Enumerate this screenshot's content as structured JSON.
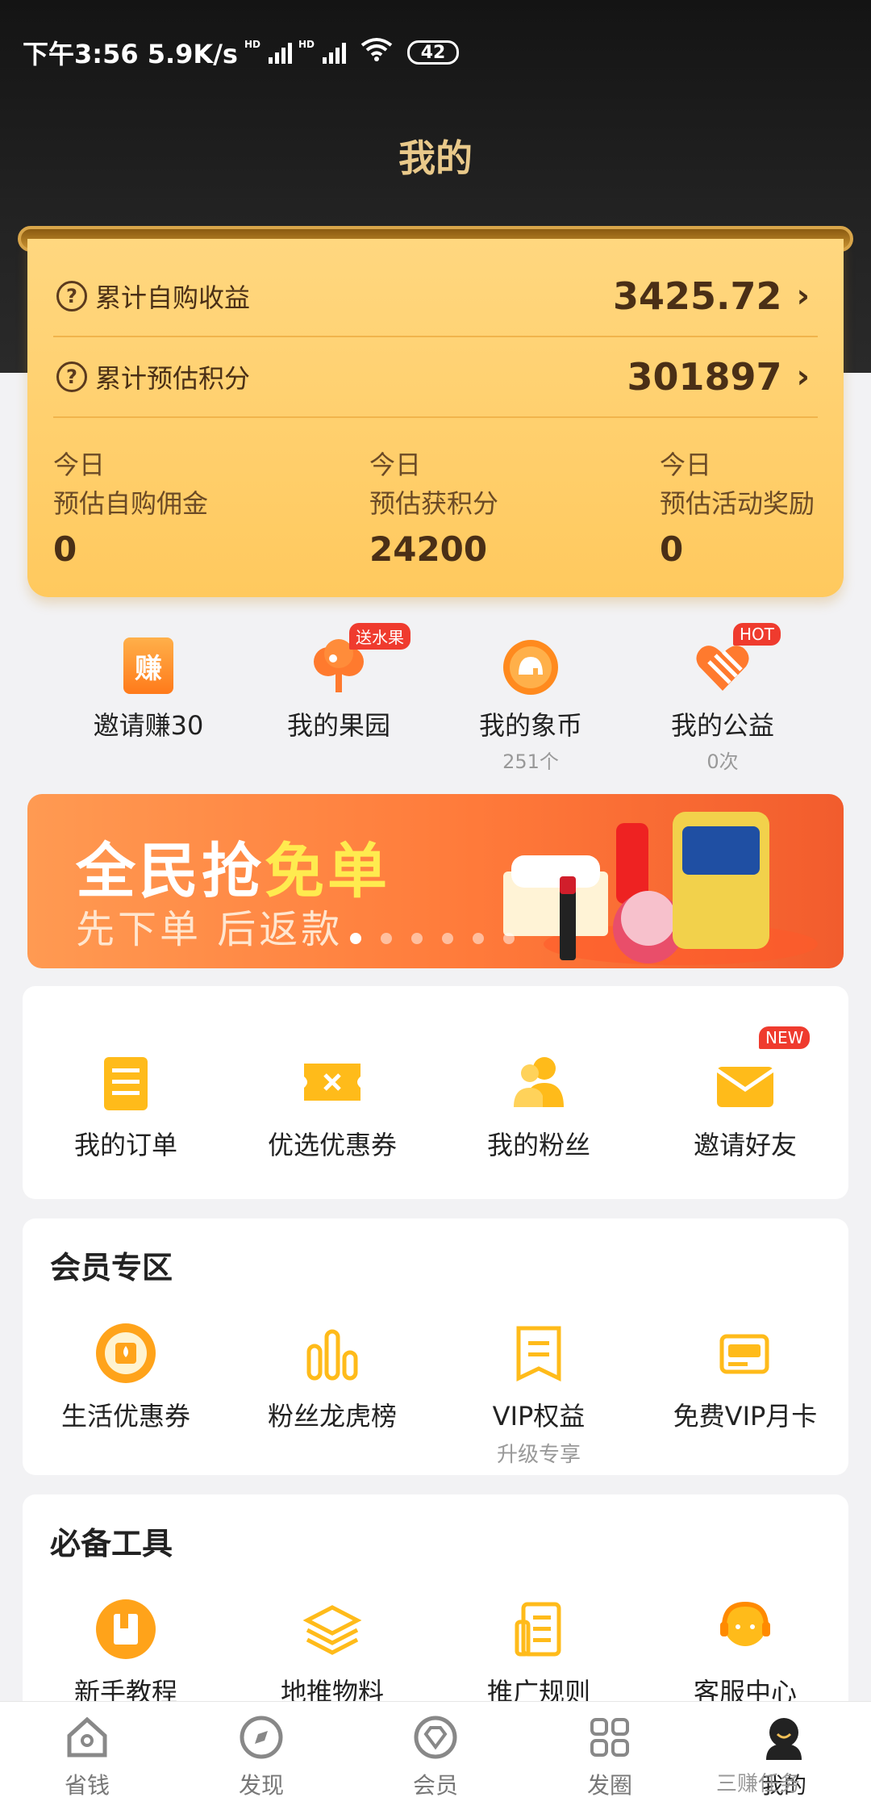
{
  "status_bar": {
    "time_speed": "下午3:56 5.9K/s",
    "hd_a": "HD",
    "hd_b": "HD",
    "battery": "42"
  },
  "header": {
    "title": "我的"
  },
  "earnings_card": {
    "rows": [
      {
        "label": "累计自购收益",
        "value": "3425.72"
      },
      {
        "label": "累计预估积分",
        "value": "301897"
      }
    ],
    "today": [
      {
        "line1": "今日",
        "line2": "预估自购佣金",
        "value": "0"
      },
      {
        "line1": "今日",
        "line2": "预估获积分",
        "value": "24200"
      },
      {
        "line1": "今日",
        "line2": "预估活动奖励",
        "value": "0"
      }
    ]
  },
  "quick_actions": [
    {
      "label": "邀请赚30",
      "icon": "earn-icon",
      "glyph": "赚"
    },
    {
      "label": "我的果园",
      "icon": "tree-icon",
      "tag": "送水果"
    },
    {
      "label": "我的象币",
      "icon": "elephant-coin-icon",
      "sub": "251个"
    },
    {
      "label": "我的公益",
      "icon": "charity-heart-icon",
      "tag": "HOT",
      "sub": "0次"
    }
  ],
  "banner": {
    "title_a": "全民抢",
    "title_b": "免单",
    "subtitle": "先下单 后返款",
    "slides": 6,
    "active": 0
  },
  "orders_panel": {
    "items": [
      {
        "label": "我的订单",
        "icon": "orders-icon"
      },
      {
        "label": "优选优惠券",
        "icon": "coupon-icon"
      },
      {
        "label": "我的粉丝",
        "icon": "fans-icon"
      },
      {
        "label": "邀请好友",
        "icon": "invite-envelope-icon",
        "tag": "NEW"
      }
    ]
  },
  "member_panel": {
    "title": "会员专区",
    "items": [
      {
        "label": "生活优惠券",
        "icon": "life-coupon-icon"
      },
      {
        "label": "粉丝龙虎榜",
        "icon": "ranking-bars-icon"
      },
      {
        "label": "VIP权益",
        "icon": "vip-rights-icon",
        "sub": "升级专享"
      },
      {
        "label": "免费VIP月卡",
        "icon": "vip-card-icon"
      }
    ]
  },
  "tools_panel": {
    "title": "必备工具",
    "items": [
      {
        "label": "新手教程",
        "icon": "tutorial-book-icon"
      },
      {
        "label": "地推物料",
        "icon": "materials-layers-icon"
      },
      {
        "label": "推广规则",
        "icon": "rules-doc-icon"
      },
      {
        "label": "客服中心",
        "icon": "customer-service-icon"
      }
    ]
  },
  "tab_bar": [
    {
      "label": "省钱",
      "icon": "home-icon"
    },
    {
      "label": "发现",
      "icon": "compass-icon"
    },
    {
      "label": "会员",
      "icon": "diamond-icon"
    },
    {
      "label": "发圈",
      "icon": "grid-icon"
    },
    {
      "label": "我的",
      "icon": "profile-icon",
      "active": true
    }
  ],
  "watermark": "三赚任务",
  "colors": {
    "accent": "#ffc95e",
    "header_bg": "#1c1c1c",
    "title_gold": "#e9c98a",
    "icon_orange": "#ffa31a",
    "tag_red": "#ef3b2e"
  }
}
